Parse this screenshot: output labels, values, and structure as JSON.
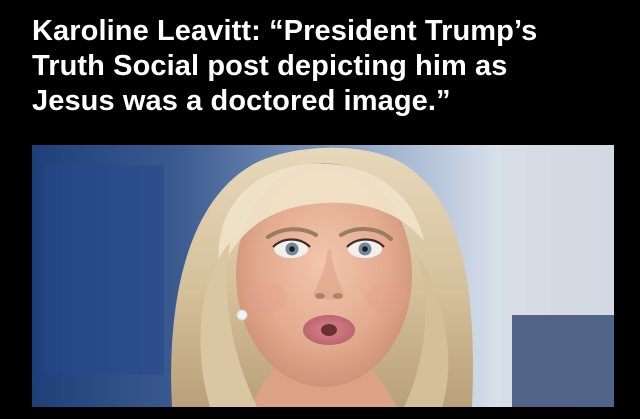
{
  "headline": {
    "lines": [
      "Karoline Leavitt: “President Trump’s",
      "Truth Social post depicting him as",
      "Jesus was a doctored image.”"
    ]
  },
  "photo": {
    "subject": "photo-of-woman-with-blonde-hair",
    "background_colors": [
      "#274d89",
      "#6a7ea7",
      "#d9e0ea"
    ]
  }
}
